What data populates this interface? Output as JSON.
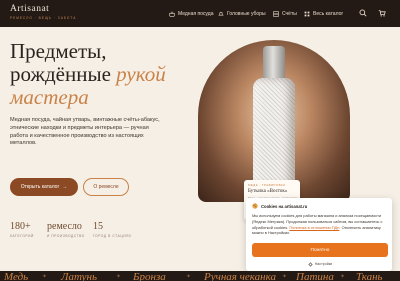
{
  "header": {
    "logo": "Artisanat",
    "tagline": "РЕМЕСЛО · ВЕЩЬ · ЗАБОТА",
    "nav": [
      {
        "label": "Медная посуда",
        "icon": "pot-icon"
      },
      {
        "label": "Головные уборы",
        "icon": "hat-icon"
      },
      {
        "label": "Счёты",
        "icon": "abacus-icon"
      },
      {
        "label": "Весь каталог",
        "icon": "grid-icon"
      }
    ]
  },
  "hero": {
    "title_line1": "Предметы,",
    "title_line2a": "рождённые ",
    "title_line2b": "рукой",
    "title_line3": "мастера",
    "description": "Медная посуда, чайная утварь, винтажные счёты-абакус, этнические находки и предметы интерьера — ручная работа и качественное производство из настоящих металлов.",
    "btn_catalog": "Открыть каталог",
    "btn_about": "О ремесле"
  },
  "stats": [
    {
      "value": "180+",
      "label": "КАТЕГОРИЙ"
    },
    {
      "value": "ремесло",
      "label": "И ПРОИЗВОДСТВО"
    },
    {
      "value": "15",
      "label": "ГОРОД В СТАЦИЯХ"
    }
  ],
  "product_card": {
    "category": "МЕДЬ · ГРАВИРОВКА",
    "title": "Бутылка «Восток»",
    "desc": "Медь · ручная чеканка · гравировка"
  },
  "cookie": {
    "title": "Cookies на artisanat.ru",
    "body_text": "Мы используем cookies для работы магазина и анализа посещаемости (Яндекс Метрика). Продолжая пользоваться сайтом, вы соглашаетесь с обработкой cookies. ",
    "link1": "Политика в отношении ПДн",
    "body_text2": ". Отключить аналитику можно в Настройках.",
    "accept": "Понятно",
    "settings": "Настройки"
  },
  "marquee": [
    "Медь",
    "Латунь",
    "Бронза",
    "Ручная чеканка",
    "Патина",
    "Ткань"
  ],
  "colors": {
    "accent": "#c98248",
    "button": "#8b4a24",
    "cookie_button": "#e8731e",
    "header_bg": "#241a15"
  }
}
